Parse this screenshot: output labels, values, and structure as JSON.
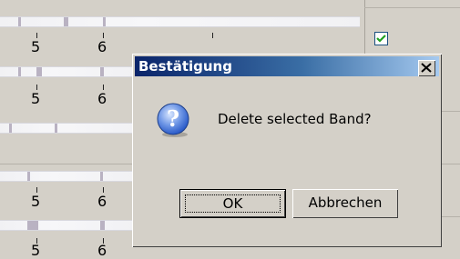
{
  "background": {
    "ruler_numbers": [
      "5",
      "6",
      "5",
      "6",
      "5",
      "6",
      "5",
      "6"
    ]
  },
  "dialog": {
    "title": "Bestätigung",
    "message": "Delete selected Band?",
    "ok_label": "OK",
    "cancel_label": "Abbrechen",
    "icon": "question-icon",
    "close_icon": "close-icon"
  },
  "colors": {
    "titlebar_start": "#0a246a",
    "titlebar_end": "#a6caf0",
    "window_bg": "#d4d0c8",
    "question_icon": "#2a5ac8"
  }
}
